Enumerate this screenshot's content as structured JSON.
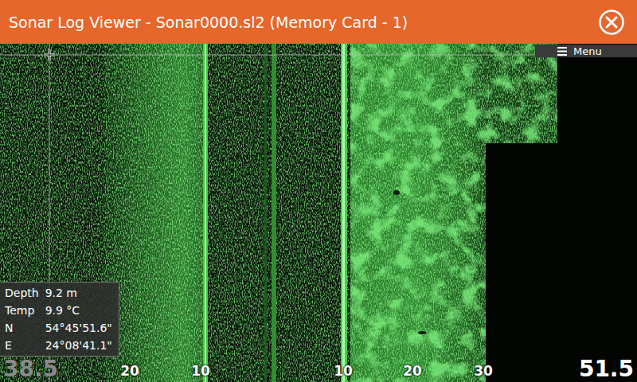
{
  "window": {
    "title": "Sonar Log Viewer - Sonar0000.sl2 (Memory Card - 1)"
  },
  "menu": {
    "label": "Menu"
  },
  "readouts": [
    {
      "label": "Depth",
      "value": "9.2 m"
    },
    {
      "label": "Temp",
      "value": "9.9 °C"
    },
    {
      "label": "N",
      "value": "54°45'51.6\""
    },
    {
      "label": "E",
      "value": "24°08'41.1\""
    }
  ],
  "range": {
    "left": "38.5",
    "right": "51.5"
  },
  "scale": [
    "20",
    "10",
    "10",
    "20",
    "30"
  ]
}
